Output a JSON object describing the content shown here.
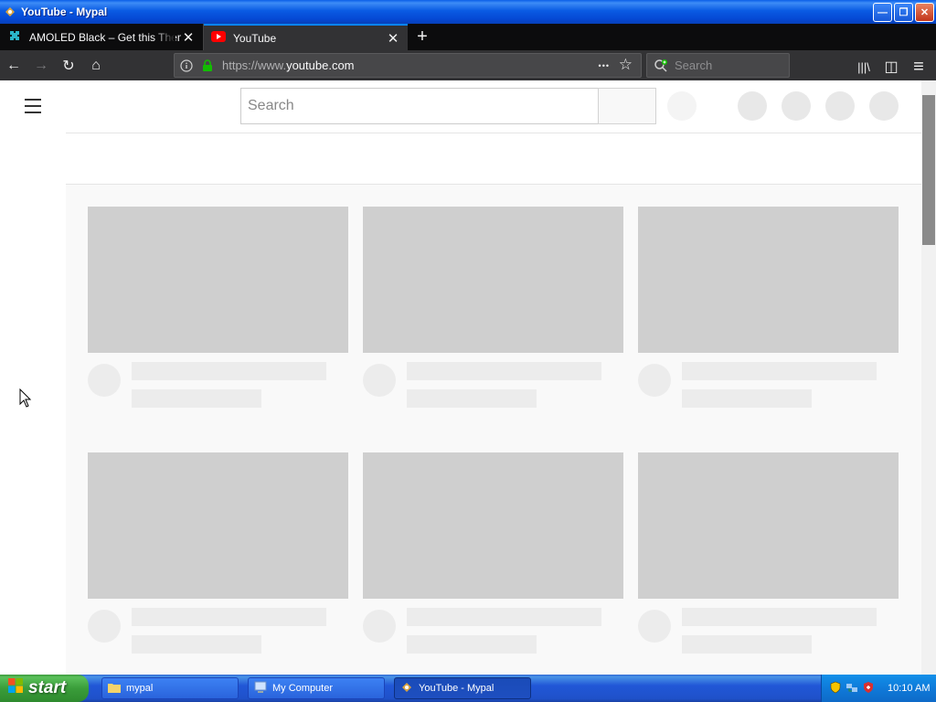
{
  "window": {
    "title": "YouTube - Mypal",
    "minimize_glyph": "—",
    "restore_glyph": "❐",
    "close_glyph": "✕"
  },
  "tabs": [
    {
      "label": "AMOLED Black – Get this Theme f",
      "active": false,
      "icon": "puzzle-icon"
    },
    {
      "label": "YouTube",
      "active": true,
      "icon": "youtube-icon"
    }
  ],
  "tab_close_glyph": "✕",
  "new_tab_glyph": "+",
  "navbar": {
    "back_glyph": "←",
    "forward_glyph": "→",
    "reload_glyph": "↻",
    "home_glyph": "⌂",
    "url_prefix": "https://www.",
    "url_host": "youtube.com",
    "page_actions_glyph": "•••",
    "bookmark_glyph": "☆",
    "search_placeholder": "Search",
    "library_glyph": "|||\\",
    "sidebar_glyph": "◫",
    "menu_glyph": "≡"
  },
  "youtube": {
    "search_placeholder": "Search",
    "cards": [
      {
        "row": 0,
        "col": 0
      },
      {
        "row": 0,
        "col": 1
      },
      {
        "row": 0,
        "col": 2
      },
      {
        "row": 1,
        "col": 0
      },
      {
        "row": 1,
        "col": 1
      },
      {
        "row": 1,
        "col": 2
      }
    ]
  },
  "taskbar": {
    "start_label": "start",
    "items": [
      {
        "label": "mypal",
        "icon": "folder-icon",
        "active": false
      },
      {
        "label": "My Computer",
        "icon": "computer-icon",
        "active": false
      },
      {
        "label": "YouTube - Mypal",
        "icon": "mypal-icon",
        "active": true
      }
    ],
    "clock": "10:10 AM"
  },
  "colors": {
    "accent_tab": "#0a84ff",
    "browser_chrome": "#323234",
    "tabstrip": "#0c0c0d",
    "skeleton_thumb": "#cfcfcf",
    "skeleton_text": "#ececec",
    "youtube_red": "#ff0000",
    "lock_green": "#12bc00"
  }
}
